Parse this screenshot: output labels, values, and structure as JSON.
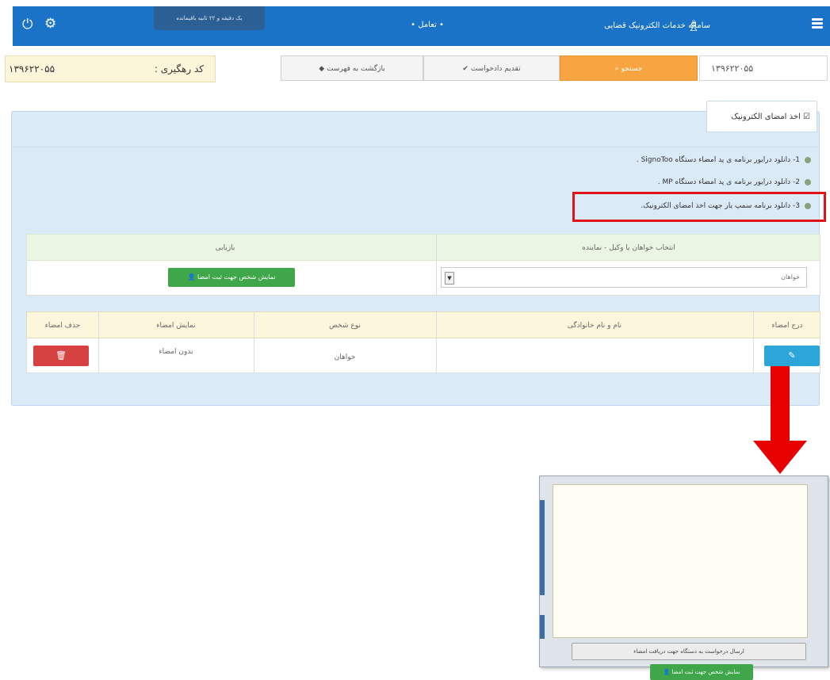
{
  "topbar": {
    "session_text": "یک دقیقه و ۲۲ ثانیه باقیمانده",
    "menu_item": "• تعامل •",
    "brand": "سامانه خدمات الکترونیک قضایی",
    "icons": {
      "power": "power-icon",
      "settings": "gear-icon",
      "menu": "hamburger-icon",
      "brand": "org-chart-icon"
    },
    "color": "#1a73c6"
  },
  "toolbar": {
    "tracking_number": "۱۳۹۶۲۲۰۵۵",
    "tracking_label": "کد رهگیری :",
    "back_button": "بازگشت به فهرست",
    "submit_button": "تقدیم دادخواست",
    "search_button": "جستجو",
    "case_number": "۱۳۹۶۲۲۰۵۵"
  },
  "panel": {
    "title": "اخذ امضای الکترونیک",
    "downloads": [
      "1- دانلود درایور برنامه ی پد امضاء دستگاه SignoToo .",
      "2- دانلود درایور برنامه ی پد امضاء دستگاه MP .",
      "3- دانلود برنامه سمپ یار جهت اخذ امضای الکترونیک."
    ],
    "highlight_color": "#e0131a"
  },
  "selection_table": {
    "headers": [
      "انتخاب خواهان یا وکیل - نماینده",
      "بازیابی"
    ],
    "select_value": "خواهان",
    "show_button": "نمایش شخص جهت ثبت امضا"
  },
  "signature_table": {
    "headers": [
      "درج امضاء",
      "نام و نام خانوادگی",
      "نوع شخص",
      "نمایش امضاء",
      "حذف امضاء"
    ],
    "rows": [
      {
        "name": "",
        "person_type": "خواهان",
        "signature_display": "بدون امضاء"
      }
    ],
    "edit_icon": "pencil-icon",
    "delete_icon": "trash-icon"
  },
  "popup": {
    "send_button": "ارسال درخواست به دستگاه جهت دریافت امضاء",
    "green_button": "نمایش شخص جهت ثبت امضا"
  }
}
